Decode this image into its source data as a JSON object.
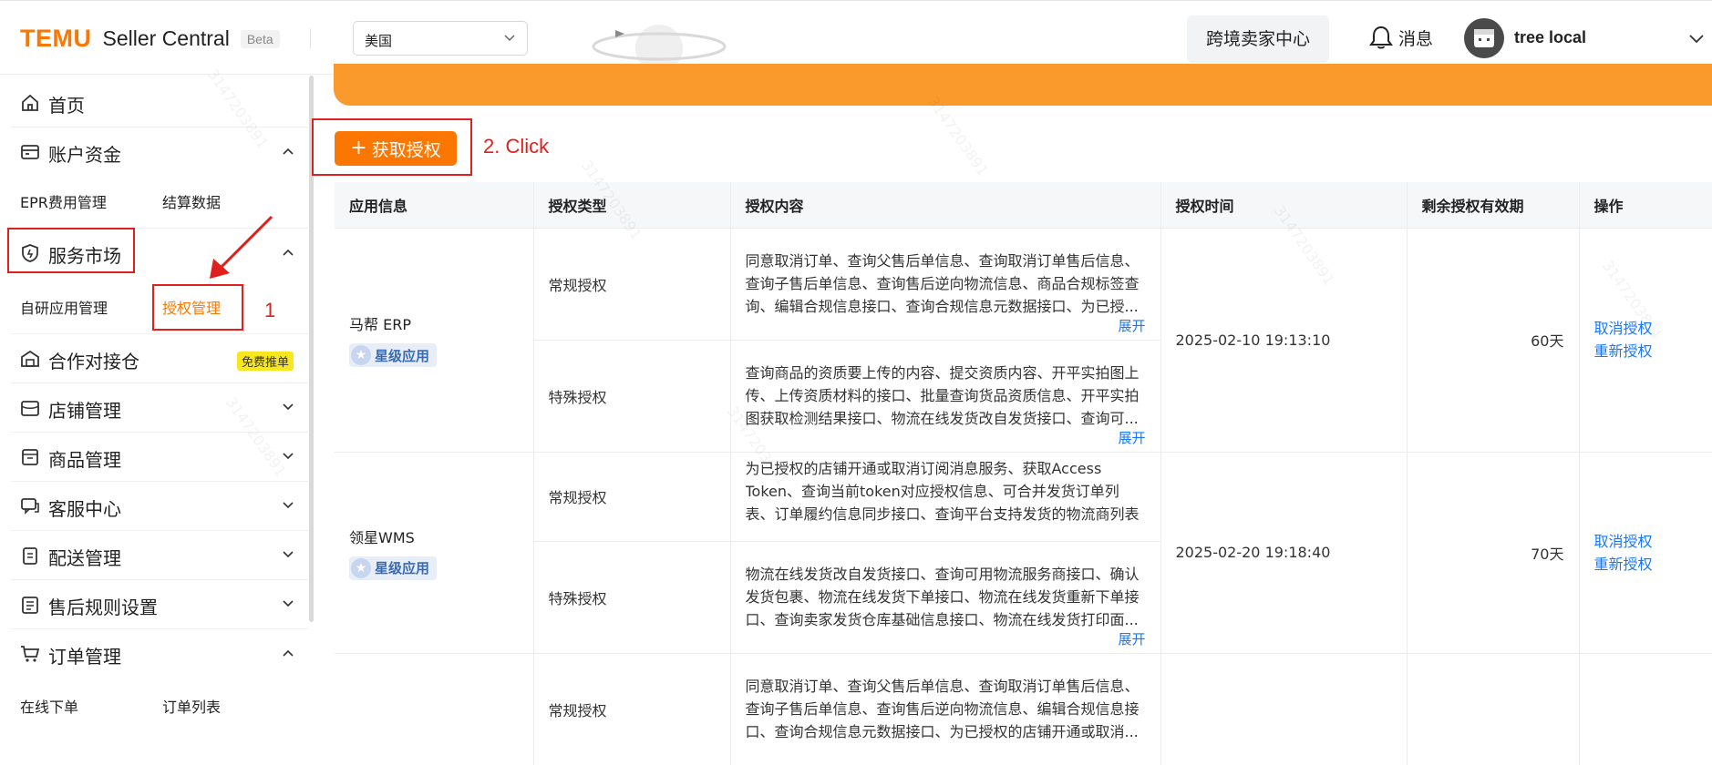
{
  "header": {
    "logo_brand": "TEMU",
    "logo_product": "Seller Central",
    "logo_badge": "Beta",
    "region": "美国",
    "cross_border_center": "跨境卖家中心",
    "messages": "消息",
    "user_name": "tree local"
  },
  "sidebar": {
    "home": "首页",
    "account_funds": "账户资金",
    "account_sub_1": "EPR费用管理",
    "account_sub_2": "结算数据",
    "service_market": "服务市场",
    "service_sub_1": "自研应用管理",
    "service_sub_2": "授权管理",
    "cooperation": "合作对接仓",
    "cooperation_badge": "免费推单",
    "store": "店铺管理",
    "goods": "商品管理",
    "customer_service": "客服中心",
    "delivery": "配送管理",
    "after_sale": "售后规则设置",
    "orders": "订单管理",
    "orders_sub_1": "在线下单",
    "orders_sub_2": "订单列表"
  },
  "annotations": {
    "step1": "1",
    "step2": "2. Click"
  },
  "main": {
    "acquire_button": "获取授权",
    "columns": [
      "应用信息",
      "授权类型",
      "授权内容",
      "授权时间",
      "剩余授权有效期",
      "操作"
    ],
    "expand": "展开",
    "cancel_auth": "取消授权",
    "reauth": "重新授权",
    "apps": [
      {
        "name": "马帮 ERP",
        "badge": "星级应用",
        "time": "2025-02-10 19:13:10",
        "remaining": "60天",
        "rows": [
          {
            "type": "常规授权",
            "content": "同意取消订单、查询父售后单信息、查询取消订单售后信息、查询子售后单信息、查询售后逆向物流信息、商品合规标签查询、编辑合规信息接口、查询合规信息元数据接口、为已授..."
          },
          {
            "type": "特殊授权",
            "content": "查询商品的资质要上传的内容、提交资质内容、开平实拍图上传、上传资质材料的接口、批量查询货品资质信息、开平实拍图获取检测结果接口、物流在线发货改自发货接口、查询可..."
          }
        ]
      },
      {
        "name": "领星WMS",
        "badge": "星级应用",
        "time": "2025-02-20 19:18:40",
        "remaining": "70天",
        "rows": [
          {
            "type": "常规授权",
            "content": "为已授权的店铺开通或取消订阅消息服务、获取Access Token、查询当前token对应授权信息、可合并发货订单列表、订单履约信息同步接口、查询平台支持发货的物流商列表"
          },
          {
            "type": "特殊授权",
            "content": "物流在线发货改自发货接口、查询可用物流服务商接口、确认发货包裹、物流在线发货下单接口、物流在线发货重新下单接口、查询卖家发货仓库基础信息接口、物流在线发货打印面..."
          }
        ]
      },
      {
        "rows": [
          {
            "type": "常规授权",
            "content": "同意取消订单、查询父售后单信息、查询取消订单售后信息、查询子售后单信息、查询售后逆向物流信息、编辑合规信息接口、查询合规信息元数据接口、为已授权的店铺开通或取消..."
          }
        ]
      }
    ]
  },
  "watermark": "3147203891",
  "colors": {
    "brand": "#fb7701",
    "banner": "#fb9a2c",
    "link": "#1677ff",
    "annotation": "#e0201c"
  }
}
